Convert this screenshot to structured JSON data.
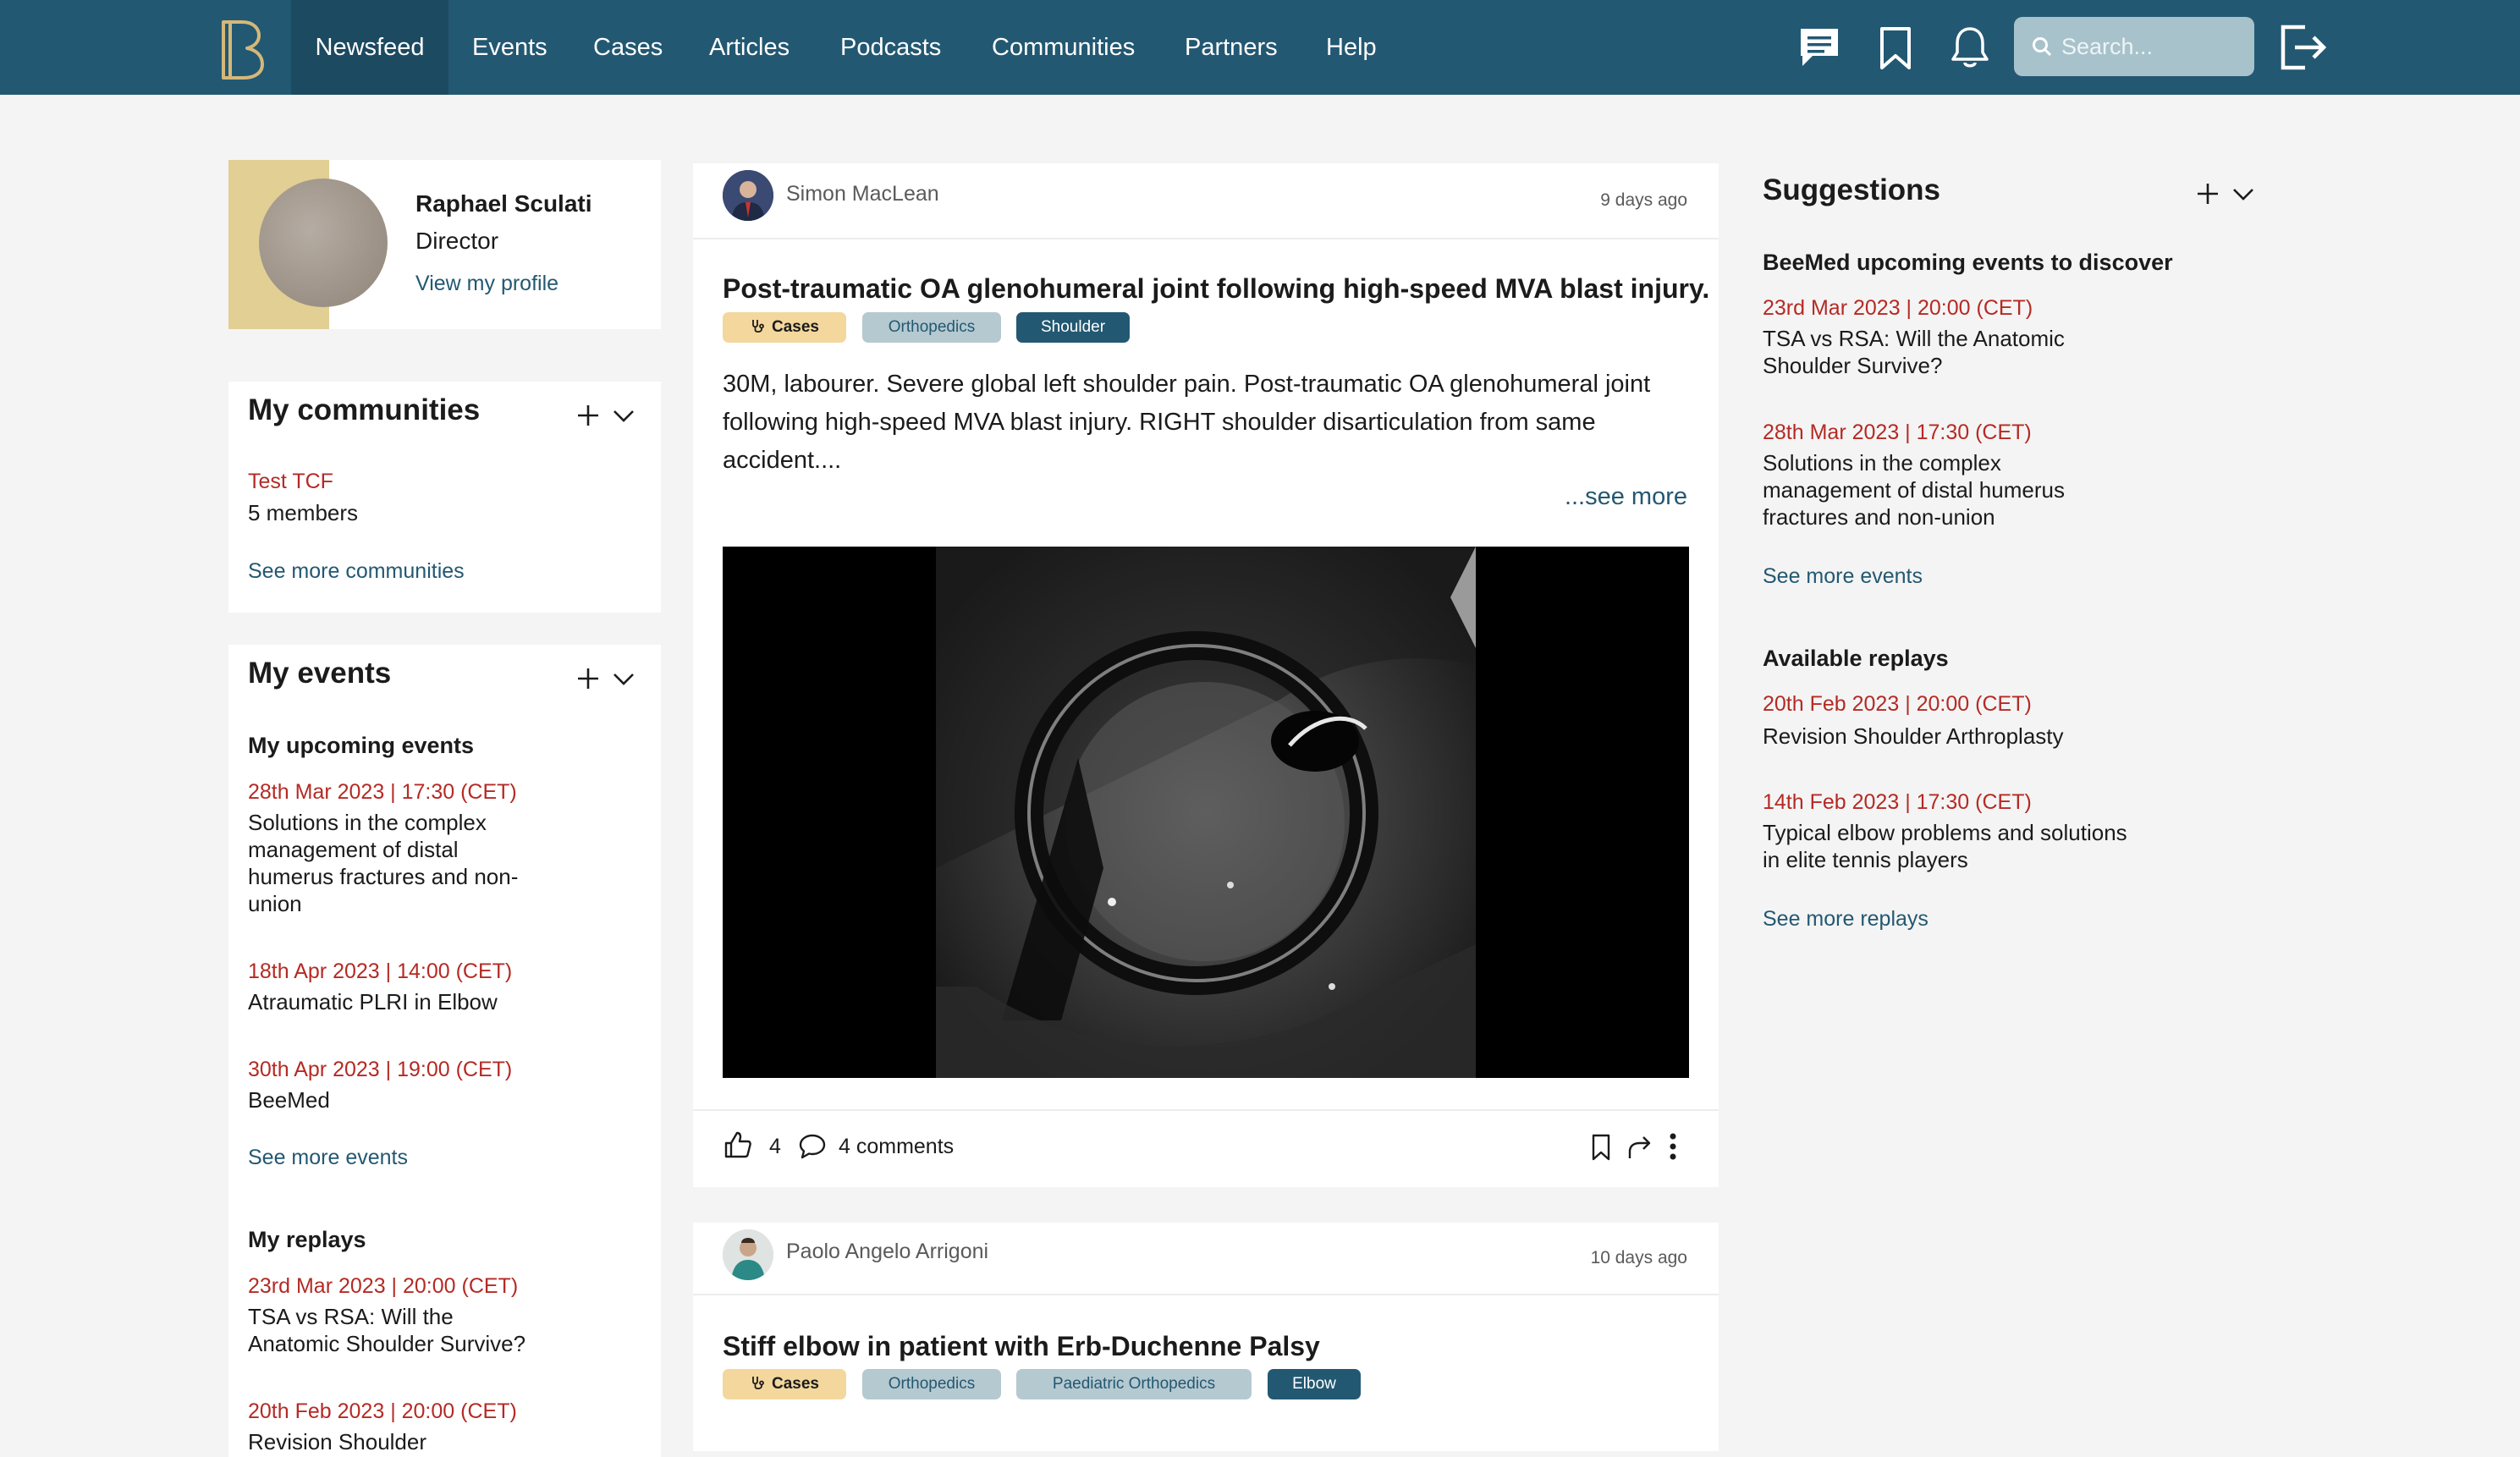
{
  "nav": {
    "items": [
      {
        "label": "Newsfeed",
        "active": true
      },
      {
        "label": "Events"
      },
      {
        "label": "Cases"
      },
      {
        "label": "Articles"
      },
      {
        "label": "Podcasts"
      },
      {
        "label": "Communities"
      },
      {
        "label": "Partners"
      },
      {
        "label": "Help"
      }
    ],
    "search_placeholder": "Search...",
    "icons": [
      "chat-icon",
      "bookmark-icon",
      "bell-icon",
      "search-icon",
      "logout-icon"
    ]
  },
  "profile": {
    "name": "Raphael Sculati",
    "role": "Director",
    "link": "View my profile"
  },
  "communities": {
    "title": "My communities",
    "items": [
      {
        "name": "Test TCF",
        "members": "5 members"
      }
    ],
    "more": "See more communities"
  },
  "events": {
    "title": "My events",
    "upcoming_title": "My upcoming events",
    "upcoming": [
      {
        "date": "28th Mar 2023 | 17:30 (CET)",
        "title_lines": [
          "Solutions in the complex",
          "management of distal",
          "humerus fractures and non-",
          "union"
        ]
      },
      {
        "date": "18th Apr 2023 | 14:00 (CET)",
        "title_lines": [
          "Atraumatic PLRI in Elbow"
        ]
      },
      {
        "date": "30th Apr 2023 | 19:00 (CET)",
        "title_lines": [
          "BeeMed"
        ]
      }
    ],
    "more_events": "See more events",
    "replays_title": "My replays",
    "replays": [
      {
        "date": "23rd Mar 2023 | 20:00 (CET)",
        "title_lines": [
          "TSA vs RSA: Will the",
          "Anatomic Shoulder Survive?"
        ]
      },
      {
        "date": "20th Feb 2023 | 20:00 (CET)",
        "title_lines": [
          "Revision Shoulder"
        ]
      }
    ]
  },
  "posts": [
    {
      "author": "Simon MacLean",
      "time": "9 days ago",
      "title": "Post-traumatic OA glenohumeral joint following high-speed MVA blast injury.",
      "tags": [
        "Cases",
        "Orthopedics",
        "Shoulder"
      ],
      "body_lines": [
        "30M, labourer. Severe global left shoulder pain. Post-traumatic OA glenohumeral joint",
        "following high-speed MVA blast injury. RIGHT shoulder disarticulation from same",
        "accident...."
      ],
      "see_more": "...see more",
      "likes": "4",
      "comments": "4 comments"
    },
    {
      "author": "Paolo Angelo Arrigoni",
      "time": "10 days ago",
      "title": "Stiff elbow in patient with Erb-Duchenne Palsy",
      "tags": [
        "Cases",
        "Orthopedics",
        "Paediatric Orthopedics",
        "Elbow"
      ]
    }
  ],
  "suggestions": {
    "title": "Suggestions",
    "events_title": "BeeMed upcoming events to discover",
    "events": [
      {
        "date": "23rd Mar 2023 | 20:00 (CET)",
        "title_lines": [
          "TSA vs RSA: Will the Anatomic",
          "Shoulder Survive?"
        ]
      },
      {
        "date": "28th Mar 2023 | 17:30 (CET)",
        "title_lines": [
          "Solutions in the complex",
          "management of distal humerus",
          "fractures and non-union"
        ]
      }
    ],
    "more_events": "See more events",
    "replays_title": "Available replays",
    "replays": [
      {
        "date": "20th Feb 2023 | 20:00 (CET)",
        "title_lines": [
          "Revision Shoulder Arthroplasty"
        ]
      },
      {
        "date": "14th Feb 2023 | 17:30 (CET)",
        "title_lines": [
          "Typical elbow problems and solutions",
          "in elite tennis players"
        ]
      }
    ],
    "more_replays": "See more replays"
  },
  "colors": {
    "nav": "#235872",
    "nav_active": "#1c4a60",
    "accent_gold": "#d4b87a",
    "date_red": "#b52a24",
    "link": "#235872"
  }
}
